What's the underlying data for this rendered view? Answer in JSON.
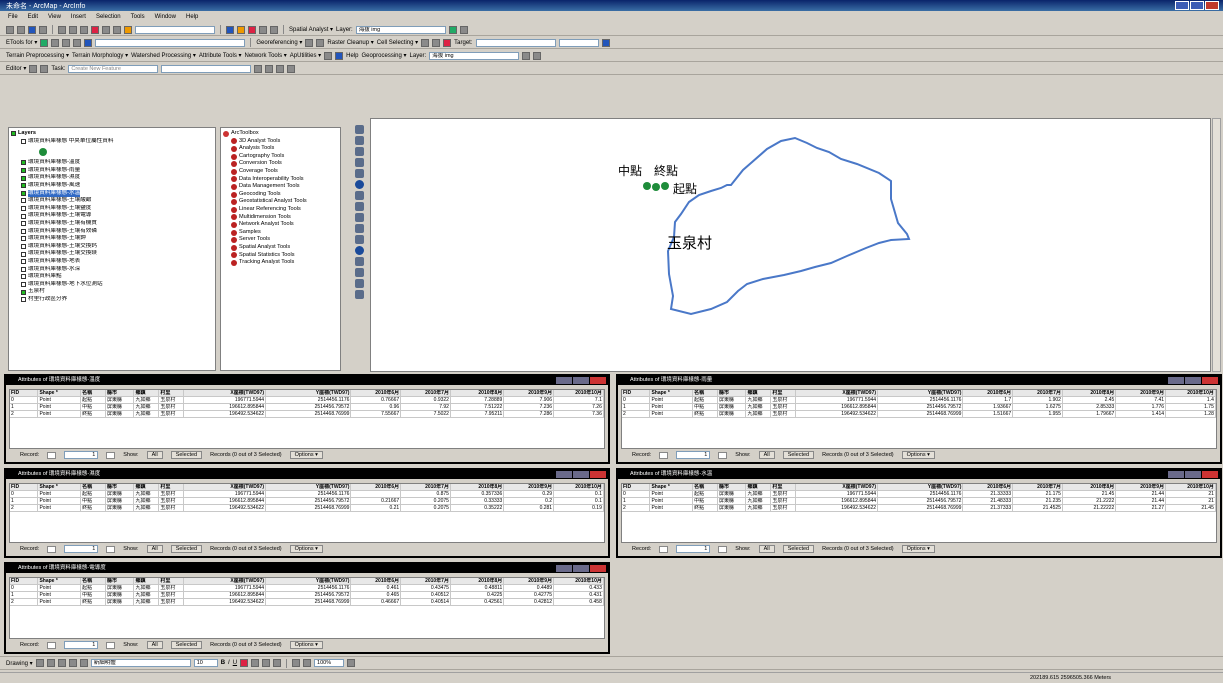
{
  "window": {
    "title": "未命名 - ArcMap - ArcInfo"
  },
  "menu": [
    "File",
    "Edit",
    "View",
    "Insert",
    "Selection",
    "Tools",
    "Window",
    "Help"
  ],
  "toolbars": {
    "standard_combo": "",
    "spatial_analyst": "Spatial Analyst ▾",
    "layer_label": "Layer:",
    "layer_value": "海拔 img",
    "etools": "ETools for ▾",
    "georef": "Georeferencing ▾",
    "raster_cleanup": "Raster Cleanup ▾",
    "cell_selection": "Cell Selecting ▾",
    "terrain_preprocessing": "Terrain Preprocessing ▾",
    "terrain_morphology": "Terrain Morphology ▾",
    "watershed": "Watershed Processing ▾",
    "attribute_tools": "Attribute Tools ▾",
    "network_tools": "Network Tools ▾",
    "apuffer": "ApUtilities ▾",
    "help": "Help",
    "geoprocessing": "Geoprocessing ▾",
    "layer2_label": "Layer:",
    "layer2_value": "海拔 img",
    "editor": "Editor ▾",
    "task_label": "Task:",
    "task_value": "Create New Feature",
    "target_label": "Target:"
  },
  "toc": {
    "root": "Layers",
    "items": [
      {
        "label": "環境資料庫樣態 中央單位屬性資料",
        "checked": false,
        "selected": false
      },
      {
        "label": "環境資料庫樣態-溫度",
        "checked": true,
        "selected": false
      },
      {
        "label": "環境資料庫樣態-雨量",
        "checked": true,
        "selected": false
      },
      {
        "label": "環境資料庫樣態-濕度",
        "checked": true,
        "selected": false
      },
      {
        "label": "環境資料庫樣態-風速",
        "checked": true,
        "selected": false
      },
      {
        "label": "環境資料庫樣態-水溫",
        "checked": true,
        "selected": true
      },
      {
        "label": "環境資料庫樣態-土壤酸鹼",
        "checked": false,
        "selected": false
      },
      {
        "label": "環境資料庫樣態-土壤鹽度",
        "checked": false,
        "selected": false
      },
      {
        "label": "環境資料庫樣態-土壤電導",
        "checked": false,
        "selected": false
      },
      {
        "label": "環境資料庫樣態-土壤有機質",
        "checked": false,
        "selected": false
      },
      {
        "label": "環境資料庫樣態-土壤有效磷",
        "checked": false,
        "selected": false
      },
      {
        "label": "環境資料庫樣態-土壤鉀",
        "checked": false,
        "selected": false
      },
      {
        "label": "環境資料庫樣態-土壤交換鈣",
        "checked": false,
        "selected": false
      },
      {
        "label": "環境資料庫樣態-土壤交換鎂",
        "checked": false,
        "selected": false
      },
      {
        "label": "環境資料庫樣態-地表",
        "checked": false,
        "selected": false
      },
      {
        "label": "環境資料庫樣態-水深",
        "checked": false,
        "selected": false
      },
      {
        "label": "環境資料庫點",
        "checked": false,
        "selected": false
      },
      {
        "label": "環境資料庫樣態-地下水位測站",
        "checked": false,
        "selected": false
      },
      {
        "label": "玉泉村",
        "checked": true,
        "selected": false
      },
      {
        "label": "村里行政區分界",
        "checked": false,
        "selected": false
      }
    ]
  },
  "toolbox": {
    "root": "ArcToolbox",
    "items": [
      "3D Analyst Tools",
      "Analysis Tools",
      "Cartography Tools",
      "Conversion Tools",
      "Coverage Tools",
      "Data Interoperability Tools",
      "Data Management Tools",
      "Geocoding Tools",
      "Geostatistical Analyst Tools",
      "Linear Referencing Tools",
      "Multidimension Tools",
      "Network Analyst Tools",
      "Samples",
      "Server Tools",
      "Spatial Analyst Tools",
      "Spatial Statistics Tools",
      "Tracking Analyst Tools"
    ]
  },
  "map": {
    "village_label": "玉泉村",
    "point_labels": [
      "中點",
      "終點",
      "起點"
    ],
    "village_color": "#4a78c8",
    "point_color": "#1e8c3a"
  },
  "attr_tables": [
    {
      "title": "Attributes of 環境資料庫樣態-溫度",
      "cols": [
        "FID",
        "Shape *",
        "名稱",
        "縣市",
        "鄉鎮",
        "村里",
        "X座標(TWD97)",
        "Y座標(TWD97)",
        "2010年6月",
        "2010年7月",
        "2010年8月",
        "2010年9月",
        "2010年10月"
      ],
      "rows": [
        [
          "0",
          "Point",
          "起點",
          "屏東縣",
          "九如鄉",
          "玉泉村",
          "196771.5944",
          "2514456.1176",
          "0.76667",
          "0.9322",
          "7.28889",
          "7.906",
          "7.1"
        ],
        [
          "1",
          "Point",
          "中點",
          "屏東縣",
          "九如鄉",
          "玉泉村",
          "196612.895844",
          "2514456.79572",
          "0.96",
          "7.92",
          "7.51222",
          "7.236",
          "7.26"
        ],
        [
          "2",
          "Point",
          "終點",
          "屏東縣",
          "九如鄉",
          "玉泉村",
          "196492.534622",
          "2514468.76999",
          "7.55667",
          "7.5022",
          "7.95211",
          "7.286",
          "7.36"
        ]
      ],
      "record": "1",
      "show_label": "Show:",
      "all": "All",
      "selected": "Selected",
      "records": "Records (0 out of 3 Selected)",
      "options": "Options ▾"
    },
    {
      "title": "Attributes of 環境資料庫樣態-雨量",
      "cols": [
        "FID",
        "Shape *",
        "名稱",
        "縣市",
        "鄉鎮",
        "村里",
        "X座標(TWD97)",
        "Y座標(TWD97)",
        "2010年6月",
        "2010年7月",
        "2010年8月",
        "2010年9月",
        "2010年10月"
      ],
      "rows": [
        [
          "0",
          "Point",
          "起點",
          "屏東縣",
          "九如鄉",
          "玉泉村",
          "196771.5944",
          "2514456.1176",
          "1.7",
          "1.902",
          "2.45",
          "7.41",
          "1.4"
        ],
        [
          "1",
          "Point",
          "中點",
          "屏東縣",
          "九如鄉",
          "玉泉村",
          "196612.895844",
          "2514456.79572",
          "1.93667",
          "1.6275",
          "2.85333",
          "1.776",
          "1.75"
        ],
        [
          "2",
          "Point",
          "終點",
          "屏東縣",
          "九如鄉",
          "玉泉村",
          "196492.534622",
          "2514468.76999",
          "1.51667",
          "1.955",
          "1.79667",
          "1.414",
          "1.28"
        ]
      ],
      "record": "1",
      "show_label": "Show:",
      "all": "All",
      "selected": "Selected",
      "records": "Records (0 out of 3 Selected)",
      "options": "Options ▾"
    },
    {
      "title": "Attributes of 環境資料庫樣態-濕度",
      "cols": [
        "FID",
        "Shape *",
        "名稱",
        "縣市",
        "鄉鎮",
        "村里",
        "X座標(TWD97)",
        "Y座標(TWD97)",
        "2010年6月",
        "2010年7月",
        "2010年8月",
        "2010年9月",
        "2010年10月"
      ],
      "rows": [
        [
          "0",
          "Point",
          "起點",
          "屏東縣",
          "九如鄉",
          "玉泉村",
          "196771.5944",
          "2514456.1176",
          "",
          "0.875",
          "0.357336",
          "0.29",
          "0.1"
        ],
        [
          "1",
          "Point",
          "中點",
          "屏東縣",
          "九如鄉",
          "玉泉村",
          "196612.895844",
          "2514456.79572",
          "0.21667",
          "0.2075",
          "0.33333",
          "0.2",
          "0.1"
        ],
        [
          "2",
          "Point",
          "終點",
          "屏東縣",
          "九如鄉",
          "玉泉村",
          "196492.534622",
          "2514468.76999",
          "0.21",
          "0.2075",
          "0.35222",
          "0.281",
          "0.19"
        ]
      ],
      "record": "1",
      "show_label": "Show:",
      "all": "All",
      "selected": "Selected",
      "records": "Records (0 out of 3 Selected)",
      "options": "Options ▾"
    },
    {
      "title": "Attributes of 環境資料庫樣態-水溫",
      "cols": [
        "FID",
        "Shape *",
        "名稱",
        "縣市",
        "鄉鎮",
        "村里",
        "X座標(TWD97)",
        "Y座標(TWD97)",
        "2010年6月",
        "2010年7月",
        "2010年8月",
        "2010年9月",
        "2010年10月"
      ],
      "rows": [
        [
          "0",
          "Point",
          "起點",
          "屏東縣",
          "九如鄉",
          "玉泉村",
          "196771.5944",
          "2514456.1176",
          "21.33333",
          "21.175",
          "21.45",
          "21.44",
          "21"
        ],
        [
          "1",
          "Point",
          "中點",
          "屏東縣",
          "九如鄉",
          "玉泉村",
          "196612.895844",
          "2514456.79572",
          "21.48333",
          "21.235",
          "21.2222",
          "21.44",
          "21"
        ],
        [
          "2",
          "Point",
          "終點",
          "屏東縣",
          "九如鄉",
          "玉泉村",
          "196492.534622",
          "2514468.76999",
          "21.37333",
          "21.4525",
          "21.22222",
          "21.27",
          "21.45"
        ]
      ],
      "record": "1",
      "show_label": "Show:",
      "all": "All",
      "selected": "Selected",
      "records": "Records (0 out of 3 Selected)",
      "options": "Options ▾"
    },
    {
      "title": "Attributes of 環境資料庫樣態-電導度",
      "cols": [
        "FID",
        "Shape *",
        "名稱",
        "縣市",
        "鄉鎮",
        "村里",
        "X座標(TWD97)",
        "Y座標(TWD97)",
        "2010年6月",
        "2010年7月",
        "2010年8月",
        "2010年9月",
        "2010年10月"
      ],
      "rows": [
        [
          "0",
          "Point",
          "起點",
          "屏東縣",
          "九如鄉",
          "玉泉村",
          "196771.5944",
          "2514456.1176",
          "0.461",
          "0.43475",
          "0.48811",
          "0.4489",
          "0.433"
        ],
        [
          "1",
          "Point",
          "中點",
          "屏東縣",
          "九如鄉",
          "玉泉村",
          "196612.895844",
          "2514456.79572",
          "0.465",
          "0.40512",
          "0.4225",
          "0.42775",
          "0.431"
        ],
        [
          "2",
          "Point",
          "終點",
          "屏東縣",
          "九如鄉",
          "玉泉村",
          "196492.534622",
          "2514468.76999",
          "0.46667",
          "0.40514",
          "0.42561",
          "0.42812",
          "0.458"
        ]
      ],
      "record": "1",
      "show_label": "Show:",
      "all": "All",
      "selected": "Selected",
      "records": "Records (0 out of 3 Selected)",
      "options": "Options ▾"
    }
  ],
  "drawing": {
    "drawing_label": "Drawing ▾",
    "font_value": "新細明體",
    "size_value": "10",
    "bold": "B",
    "italic": "I",
    "underline": "U",
    "zoom_value": "100%"
  },
  "status": {
    "coords": "202189.615  2596505.366 Meters"
  }
}
